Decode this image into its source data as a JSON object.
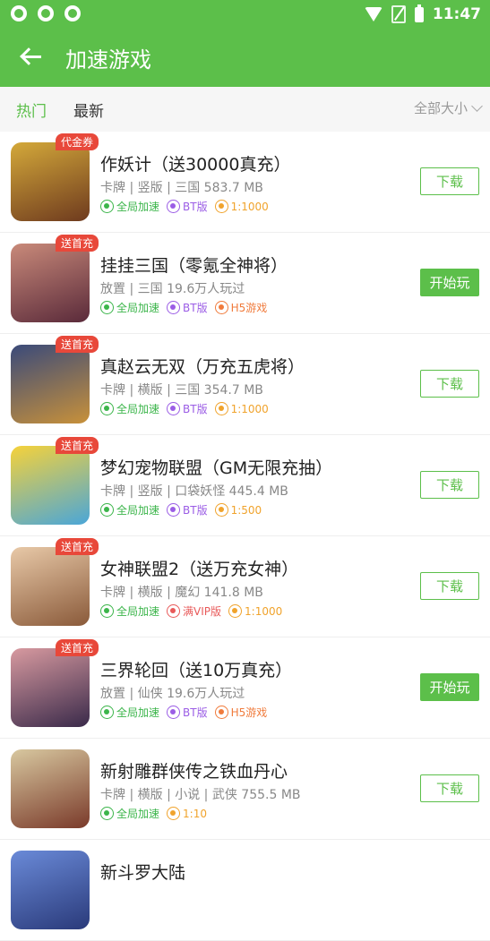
{
  "status_bar": {
    "time": "11:47"
  },
  "header": {
    "title": "加速游戏"
  },
  "tabs": {
    "hot": "热门",
    "new": "最新",
    "size_filter": "全部大小"
  },
  "games": [
    {
      "name": "作妖计（送30000真充）",
      "meta": "卡牌 | 竖版 | 三国 583.7 MB",
      "ribbon": "代金券",
      "tags": [
        "全局加速",
        "BT版",
        "1:1000"
      ],
      "button": "下载",
      "thumb_colors": [
        "#d4a93a",
        "#6e3a1e"
      ]
    },
    {
      "name": "挂挂三国（零氪全神将）",
      "meta": "放置 | 三国 19.6万人玩过",
      "ribbon": "送首充",
      "tags": [
        "全局加速",
        "BT版",
        "H5游戏"
      ],
      "button": "开始玩",
      "thumb_colors": [
        "#c98a7a",
        "#5a2a3a"
      ]
    },
    {
      "name": "真赵云无双（万充五虎将）",
      "meta": "卡牌 | 横版 | 三国 354.7 MB",
      "ribbon": "送首充",
      "tags": [
        "全局加速",
        "BT版",
        "1:1000"
      ],
      "button": "下载",
      "thumb_colors": [
        "#3a4a7a",
        "#c8913a"
      ]
    },
    {
      "name": "梦幻宠物联盟（GM无限充抽）",
      "meta": "卡牌 | 竖版 | 口袋妖怪 445.4 MB",
      "ribbon": "送首充",
      "tags": [
        "全局加速",
        "BT版",
        "1:500"
      ],
      "button": "下载",
      "thumb_colors": [
        "#f6d23a",
        "#4aa6d8"
      ]
    },
    {
      "name": "女神联盟2（送万充女神）",
      "meta": "卡牌 | 横版 | 魔幻 141.8 MB",
      "ribbon": "送首充",
      "tags": [
        "全局加速",
        "满VIP版",
        "1:1000"
      ],
      "button": "下载",
      "thumb_colors": [
        "#e8c9a8",
        "#8a5a3a"
      ]
    },
    {
      "name": "三界轮回（送10万真充）",
      "meta": "放置 | 仙侠 19.6万人玩过",
      "ribbon": "送首充",
      "tags": [
        "全局加速",
        "BT版",
        "H5游戏"
      ],
      "button": "开始玩",
      "thumb_colors": [
        "#d89aa0",
        "#3a2a4a"
      ]
    },
    {
      "name": "新射雕群侠传之铁血丹心",
      "meta": "卡牌 | 横版 | 小说 | 武侠 755.5 MB",
      "ribbon": "",
      "tags": [
        "全局加速",
        "1:10"
      ],
      "button": "下载",
      "thumb_colors": [
        "#d8c8a0",
        "#7a3a2a"
      ]
    },
    {
      "name": "新斗罗大陆",
      "meta": "",
      "ribbon": "",
      "tags": [],
      "button": "",
      "thumb_colors": [
        "#6a8ad8",
        "#2a3a7a"
      ]
    }
  ]
}
